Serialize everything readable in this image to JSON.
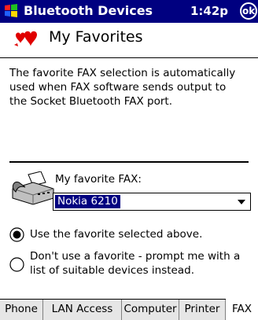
{
  "titlebar": {
    "title": "Bluetooth Devices",
    "clock": "1:42p",
    "ok_label": "ok"
  },
  "page": {
    "title": "My Favorites",
    "description_lines": [
      "The favorite FAX selection is automatically",
      "used when FAX software sends output to",
      "the Socket Bluetooth FAX port."
    ]
  },
  "fax": {
    "label": "My favorite FAX:",
    "selected": "Nokia 6210"
  },
  "options": {
    "use_favorite": {
      "label": "Use the favorite selected above.",
      "checked": true
    },
    "dont_use": {
      "lines": [
        "Don't use a favorite - prompt me with a",
        "list of suitable devices instead."
      ],
      "checked": false
    }
  },
  "tabs": [
    {
      "label": "Phone",
      "active": false
    },
    {
      "label": "LAN Access",
      "active": false
    },
    {
      "label": "Computer",
      "active": false
    },
    {
      "label": "Printer",
      "active": false
    },
    {
      "label": "FAX",
      "active": true
    }
  ],
  "colors": {
    "titlebar": "#000080",
    "selection": "#000080",
    "hearts": "#e00000"
  }
}
